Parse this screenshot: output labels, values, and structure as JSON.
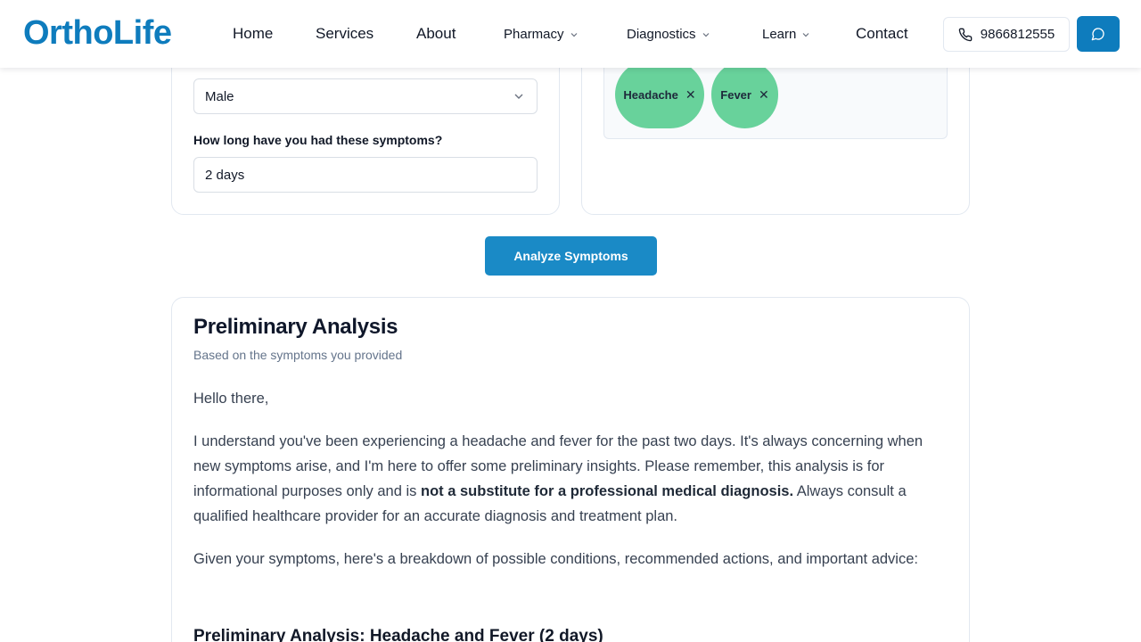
{
  "header": {
    "logo": "OrthoLife",
    "nav": [
      {
        "label": "Home"
      },
      {
        "label": "Services"
      },
      {
        "label": "About"
      },
      {
        "label": "Pharmacy"
      },
      {
        "label": "Diagnostics"
      },
      {
        "label": "Learn"
      },
      {
        "label": "Contact"
      }
    ],
    "phone": "9866812555",
    "colors": {
      "brand": "#0e7cbd"
    }
  },
  "form": {
    "gender_value": "Male",
    "duration_label": "How long have you had these symptoms?",
    "duration_value": "2 days"
  },
  "symptoms": {
    "tags": [
      {
        "label": "Headache",
        "remove_icon": "close-icon"
      },
      {
        "label": "Fever",
        "remove_icon": "close-icon"
      }
    ],
    "tag_color": "#68d29b"
  },
  "analyze_button": "Analyze Symptoms",
  "result": {
    "title": "Preliminary Analysis",
    "subtitle": "Based on the symptoms you provided",
    "greeting": "Hello there,",
    "intro_1": "I understand you've been experiencing a headache and fever for the past two days. It's always concerning when new symptoms arise, and I'm here to offer some preliminary insights. Please remember, this analysis is for informational purposes only and is ",
    "intro_bold": "not a substitute for a professional medical diagnosis.",
    "intro_2": " Always consult a qualified healthcare provider for an accurate diagnosis and treatment plan.",
    "breakdown": "Given your symptoms, here's a breakdown of possible conditions, recommended actions, and important advice:",
    "section_heading": "Preliminary Analysis: Headache and Fever (2 days)"
  }
}
